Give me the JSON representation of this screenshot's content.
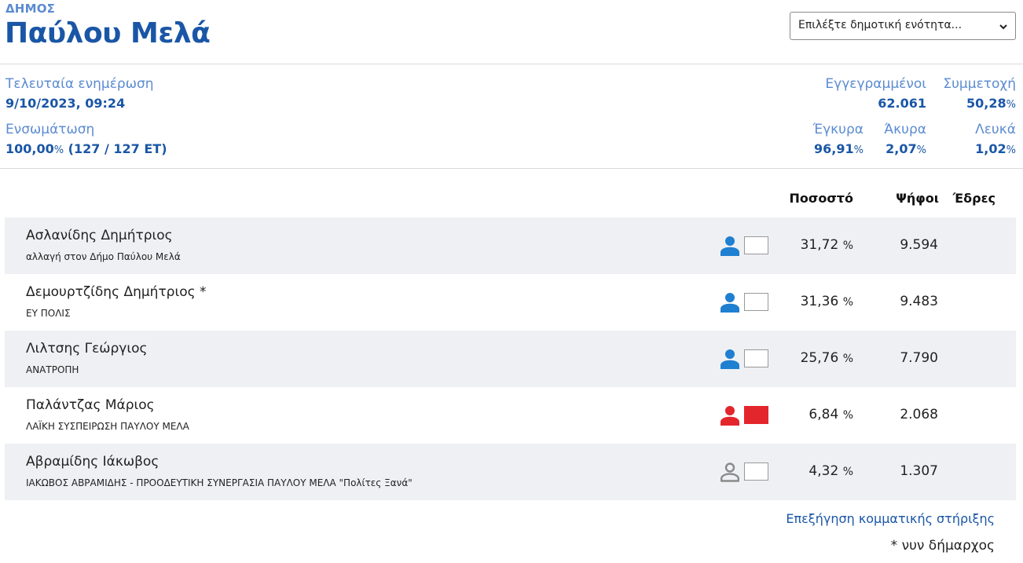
{
  "header": {
    "kicker": "ΔΗΜΟΣ",
    "title": "Παύλου Μελά",
    "select_placeholder": "Επιλέξτε δημοτική ενότητα..."
  },
  "stats": {
    "last_update_label": "Τελευταία ενημέρωση",
    "last_update_value": "9/10/2023, 09:24",
    "integration_label": "Ενσωμάτωση",
    "integration_pct": "100,00",
    "integration_rest": " (127 / 127 ΕΤ)",
    "registered_label": "Εγγεγραμμένοι",
    "registered_value": "62.061",
    "turnout_label": "Συμμετοχή",
    "turnout_value": "50,28",
    "valid_label": "Έγκυρα",
    "valid_value": "96,91",
    "invalid_label": "Άκυρα",
    "invalid_value": "2,07",
    "blank_label": "Λευκά",
    "blank_value": "1,02",
    "pct_sign": "%"
  },
  "table": {
    "col_pct": "Ποσοστό",
    "col_votes": "Ψήφοι",
    "col_seats": "Έδρες",
    "pct_unit": "%",
    "rows": [
      {
        "name": "Ασλανίδης Δημήτριος",
        "party": "αλλαγή στον Δήμο Παύλου Μελά",
        "pct": "31,72",
        "votes": "9.594",
        "icon_color": "#1f7fd0",
        "icon_style": "filled",
        "swatch": "#ffffff"
      },
      {
        "name": "Δεμουρτζίδης Δημήτριος *",
        "party": "ΕΥ ΠΟΛΙΣ",
        "pct": "31,36",
        "votes": "9.483",
        "icon_color": "#1f7fd0",
        "icon_style": "filled",
        "swatch": "#ffffff"
      },
      {
        "name": "Λιλτσης Γεώργιος",
        "party": "ΑΝΑΤΡΟΠΗ",
        "pct": "25,76",
        "votes": "7.790",
        "icon_color": "#1f7fd0",
        "icon_style": "filled",
        "swatch": "#ffffff"
      },
      {
        "name": "Παλάντζας Μάριος",
        "party": "ΛΑΪΚΗ ΣΥΣΠΕΙΡΩΣΗ ΠΑΥΛΟΥ ΜΕΛΑ",
        "pct": "6,84",
        "votes": "2.068",
        "icon_color": "#e3262b",
        "icon_style": "filled",
        "swatch": "#e3262b"
      },
      {
        "name": "Αβραμίδης Ιάκωβος",
        "party": "ΙΑΚΩΒΟΣ ΑΒΡΑΜΙΔΗΣ - ΠΡΟΟΔΕΥΤΙΚΗ ΣΥΝΕΡΓΑΣΙΑ ΠΑΥΛΟΥ ΜΕΛΑ \"Πολίτες Ξανά\"",
        "pct": "4,32",
        "votes": "1.307",
        "icon_color": "#8a8a8a",
        "icon_style": "outline",
        "swatch": "#ffffff"
      }
    ]
  },
  "footer": {
    "explain_link": "Επεξήγηση κομματικής στήριξης",
    "note": "* νυν δήμαρχος"
  },
  "icons": {
    "person": "person-icon",
    "chevron": "chevron-down-icon"
  }
}
